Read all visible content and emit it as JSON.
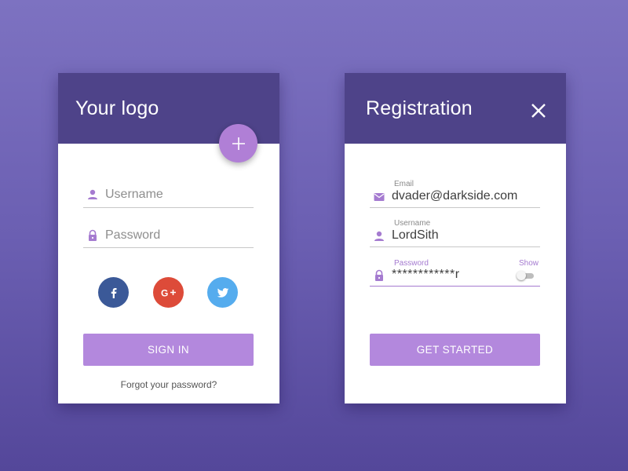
{
  "login": {
    "logo_text": "Your logo",
    "add_symbol": "+",
    "username_placeholder": "Username",
    "password_placeholder": "Password",
    "social": [
      {
        "name": "facebook",
        "icon": "facebook-icon",
        "color": "#3b5998"
      },
      {
        "name": "google-plus",
        "icon": "google-plus-icon",
        "color": "#dd4b39"
      },
      {
        "name": "twitter",
        "icon": "twitter-icon",
        "color": "#55acee"
      }
    ],
    "sign_in_label": "SIGN IN",
    "forgot_label": "Forgot your password?"
  },
  "register": {
    "title": "Registration",
    "email_label": "Email",
    "email_value": "dvader@darkside.com",
    "username_label": "Username",
    "username_value": "LordSith",
    "password_label": "Password",
    "password_value": "************r",
    "show_label": "Show",
    "show_toggle_on": false,
    "get_started_label": "GET STARTED"
  },
  "colors": {
    "header": "#4e4389",
    "accent": "#b388dd",
    "icon": "#a57bd0",
    "active_label": "#a57bd0"
  }
}
